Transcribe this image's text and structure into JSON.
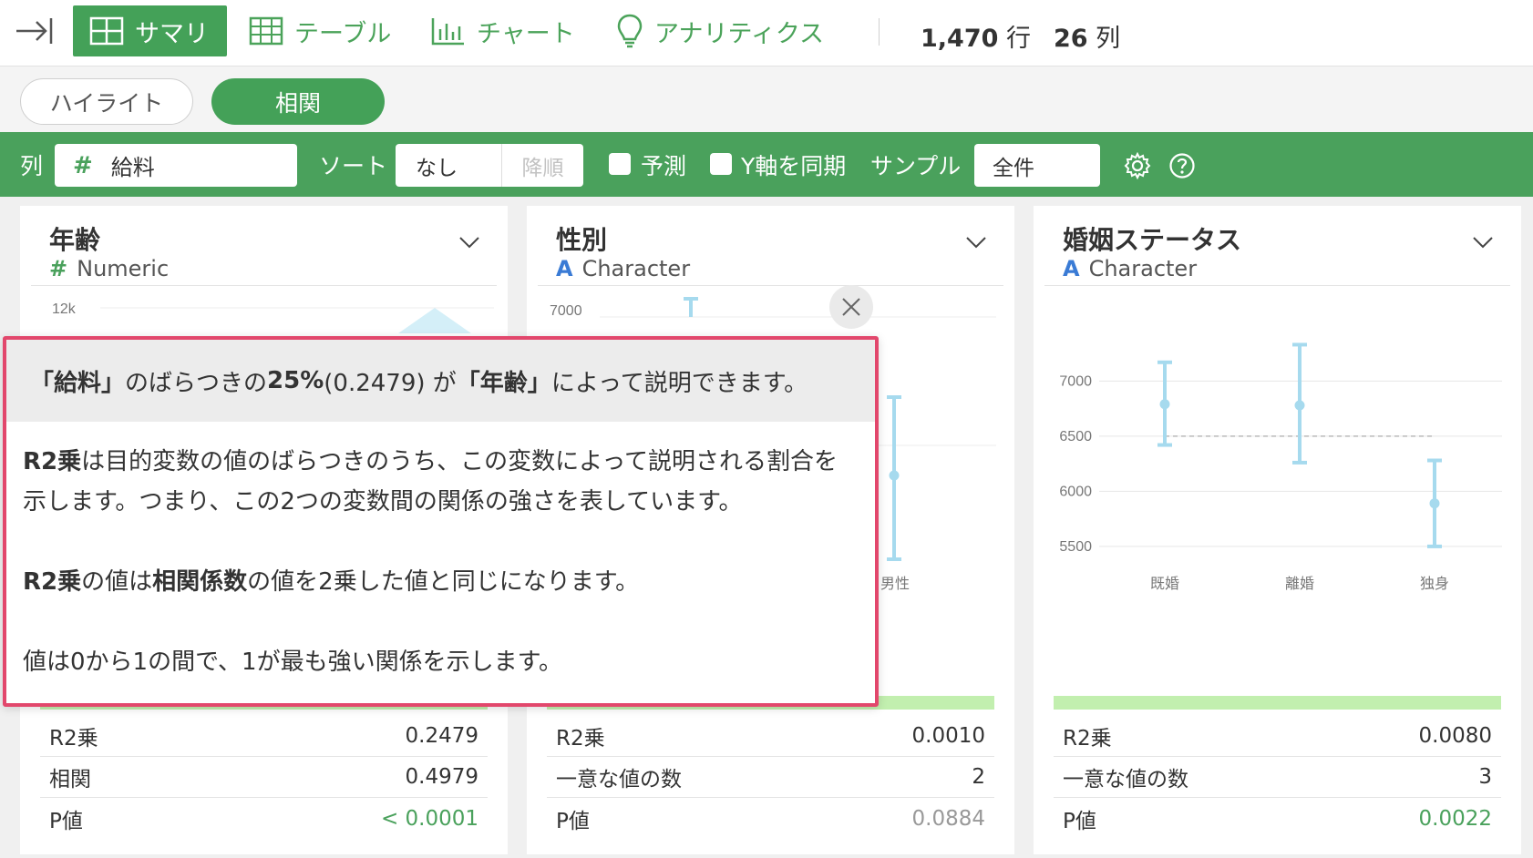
{
  "topbar": {
    "tabs": [
      {
        "label": "サマリ",
        "icon": "grid-icon",
        "active": true
      },
      {
        "label": "テーブル",
        "icon": "table-icon",
        "active": false
      },
      {
        "label": "チャート",
        "icon": "bar-chart-icon",
        "active": false
      },
      {
        "label": "アナリティクス",
        "icon": "lightbulb-icon",
        "active": false
      }
    ],
    "row_count": "1,470",
    "row_unit": "行",
    "col_count": "26",
    "col_unit": "列"
  },
  "subtabs": {
    "highlight": "ハイライト",
    "correlation": "相関"
  },
  "toolbar": {
    "col_label": "列",
    "col_value": "給料",
    "sort_label": "ソート",
    "sort_none": "なし",
    "sort_desc": "降順",
    "predict_label": "予測",
    "sync_label": "Y軸を同期",
    "sample_label": "サンプル",
    "sample_value": "全件"
  },
  "cards": [
    {
      "title": "年齢",
      "type": "Numeric",
      "type_icon": "#",
      "stats": [
        {
          "label": "R2乗",
          "value": "0.2479"
        },
        {
          "label": "相関",
          "value": "0.4979"
        },
        {
          "label": "P値",
          "value": "< 0.0001"
        }
      ],
      "chart_y_tick": "12k"
    },
    {
      "title": "性別",
      "type": "Character",
      "type_icon": "A",
      "stats": [
        {
          "label": "R2乗",
          "value": "0.0010"
        },
        {
          "label": "一意な値の数",
          "value": "2"
        },
        {
          "label": "P値",
          "value": "0.0884"
        }
      ],
      "chart_y_tick": "7000",
      "chart_x_label": "男性"
    },
    {
      "title": "婚姻ステータス",
      "type": "Character",
      "type_icon": "A",
      "stats": [
        {
          "label": "R2乗",
          "value": "0.0080"
        },
        {
          "label": "一意な値の数",
          "value": "3"
        },
        {
          "label": "P値",
          "value": "0.0022"
        }
      ]
    }
  ],
  "chart_data": {
    "type": "scatter",
    "title": "",
    "xlabel": "",
    "ylabel": "",
    "categories": [
      "既婚",
      "離婚",
      "独身"
    ],
    "y_ticks": [
      5500,
      6000,
      6500,
      7000
    ],
    "ylim": [
      5400,
      7350
    ],
    "mean": [
      6790,
      6780,
      5890
    ],
    "upper": [
      7170,
      7330,
      6280
    ],
    "lower": [
      6420,
      6260,
      5500
    ],
    "overall_mean": 6500
  },
  "tooltip": {
    "head_q1": "「給料」",
    "head_t1": "のばらつきの",
    "head_pct": "25%",
    "head_t2": " (0.2479) が",
    "head_q2": "「年齢」",
    "head_t3": "によって説明できます。",
    "p1_b": "R2乗",
    "p1_t": "は目的変数の値のばらつきのうち、この変数によって説明される割合を示します。つまり、この2つの変数間の関係の強さを表しています。",
    "p2_b1": "R2乗",
    "p2_t1": "の値は",
    "p2_b2": "相関係数",
    "p2_t2": "の値を2乗した値と同じになります。",
    "p3": "値は0から1の間で、1が最も強い関係を示します。"
  },
  "colors": {
    "brand_green": "#4aa15c",
    "tooltip_border": "#e2476c",
    "errorbar": "#a6daee",
    "corr_bar": "#c2efaf"
  }
}
